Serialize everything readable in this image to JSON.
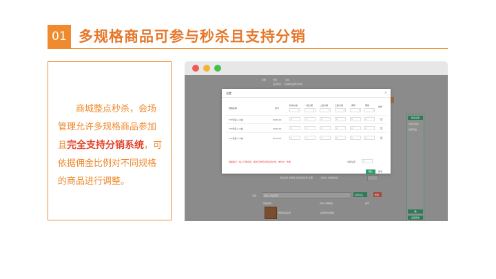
{
  "header": {
    "number": "01",
    "title": "多规格商品可参与秒杀且支持分销"
  },
  "description": {
    "part1": "商城整点秒杀，会场管理允许多规格商品参加且",
    "highlight": "完全支持分销系统",
    "part2": "，可依据佣金比例对不同规格的商品进行调整。"
  },
  "app": {
    "background": {
      "row1_labels": [
        "同属",
        "全部",
        "请在"
      ],
      "row1_sub": "设置秒杀： 可选择商品参与秒杀",
      "right_panel": {
        "tag_top": "秒杀设置",
        "item1": "可参与秒杀",
        "item2": "选择商品",
        "tag_mid": "确",
        "tag_bottom": "设置完成"
      },
      "row_product_1": "商品名称 多规格 商品测试名称 说明",
      "row_product_2": "秒杀价 多规格商品",
      "search_label": "商品",
      "search_value": "请输入商品名称",
      "add_button": "选择商品",
      "del_button": "删除",
      "columns": [
        "商品名称",
        "秒杀/分销规格",
        "操作"
      ],
      "bottom_product": "规格商品名称",
      "bottom_select": "请选择秒杀规格"
    },
    "modal": {
      "title": "设置",
      "close": "×",
      "headers": [
        "规格名称",
        "原价",
        "秒杀价格",
        "一级分佣",
        "二级分佣",
        "三级分佣",
        "库存",
        "限购",
        "操作"
      ],
      "rows": [
        {
          "name": "TYP包装+10袋",
          "price": "¥280.00"
        },
        {
          "name": "TYP包装+10袋",
          "price": "¥280.00"
        },
        {
          "name": "TYP包装+10袋",
          "price": "¥198.00"
        }
      ],
      "cell_placeholder": "0",
      "hint": "温馨提示：每人可购买的，超出可参照比较设置比例，单位为：件数",
      "batch_label": "全部设置",
      "confirm": "确认",
      "cancel": "取消"
    }
  }
}
